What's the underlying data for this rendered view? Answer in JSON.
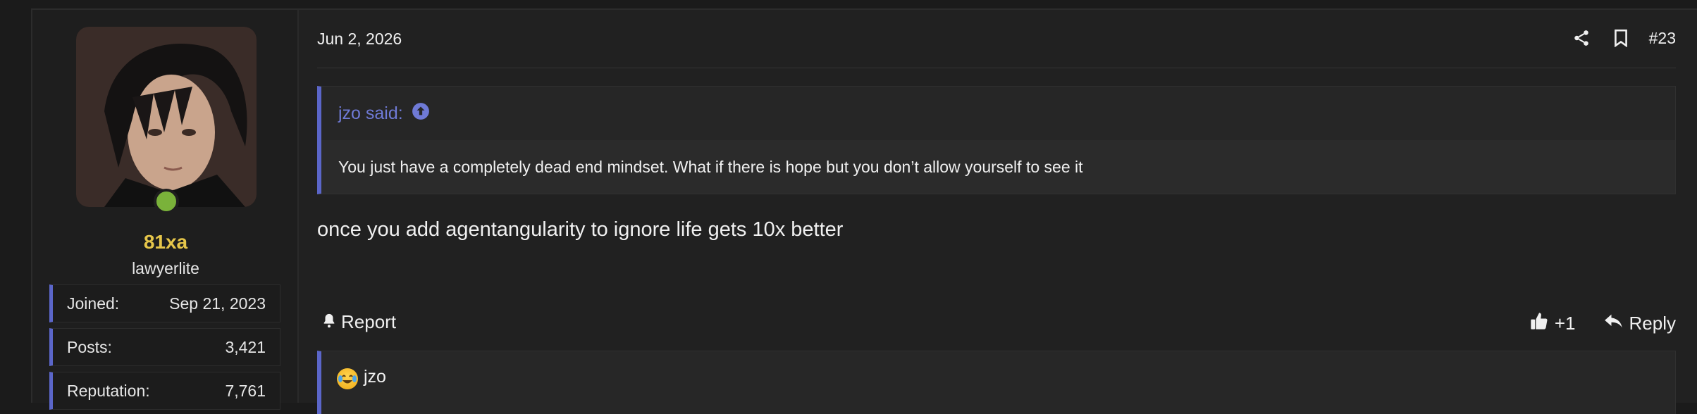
{
  "user": {
    "username": "81xa",
    "title": "lawyerlite",
    "stats": [
      {
        "label": "Joined:",
        "value": "Sep 21, 2023"
      },
      {
        "label": "Posts:",
        "value": "3,421"
      },
      {
        "label": "Reputation:",
        "value": "7,761"
      }
    ],
    "online_color": "#7ab23a",
    "username_color": "#e6c64a"
  },
  "post": {
    "date": "Jun 2, 2026",
    "number": "#23",
    "header_icons": [
      "share-icon",
      "bookmark-icon"
    ],
    "quote": {
      "author_label": "jzo said:",
      "text": "You just have a completely dead end mindset. What if there is hope but you don’t allow yourself to see it"
    },
    "message": "once you add agentangularity to ignore life gets 10x better",
    "report_label": "Report",
    "like_label": "+1",
    "reply_label": "Reply",
    "reactions": {
      "emoji_icon": "crying-laughing-emoji-icon",
      "users": "jzo"
    },
    "accent_color": "#5b66c9"
  }
}
